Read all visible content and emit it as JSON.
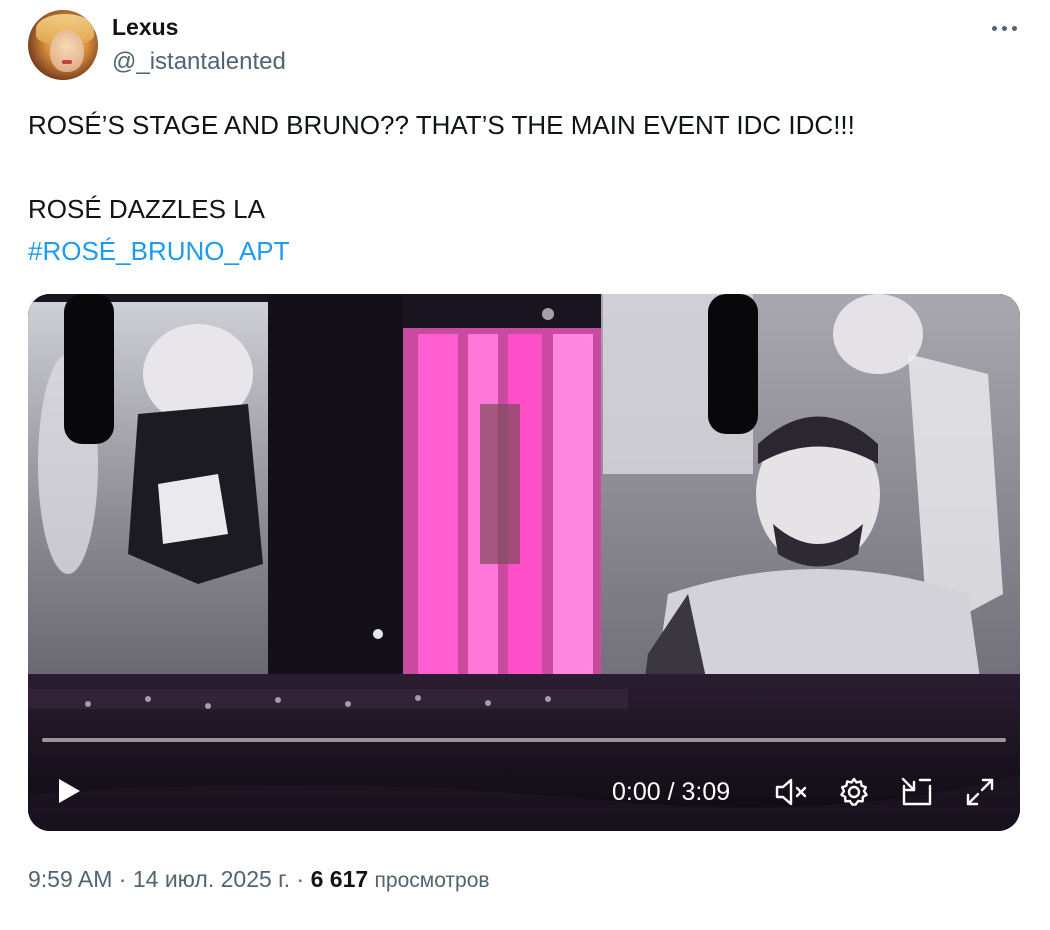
{
  "author": {
    "name": "Lexus",
    "handle": "@_istantalented"
  },
  "tweet": {
    "line1": "ROSÉ’S STAGE AND BRUNO?? THAT’S THE MAIN EVENT IDC IDC!!!",
    "line2": "ROSÉ DAZZLES LA",
    "hashtag": "#ROSÉ_BRUNO_APT"
  },
  "video": {
    "current_time": "0:00",
    "separator": "/",
    "duration": "3:09",
    "progress_fraction": 0
  },
  "meta": {
    "time": "9:59 AM",
    "dot1": "·",
    "date": "14 июл. 2025 г.",
    "dot2": "·",
    "views_count": "6 617",
    "views_label": "просмотров"
  },
  "icons": {
    "more": "more-horizontal-icon",
    "play": "play-icon",
    "mute": "volume-muted-icon",
    "settings": "gear-icon",
    "pip": "picture-in-picture-icon",
    "fullscreen": "fullscreen-icon"
  },
  "colors": {
    "accent": "#1d9bf0",
    "text": "#0f1419",
    "secondary": "#536471",
    "screen_pink": "#ff3fc4"
  }
}
